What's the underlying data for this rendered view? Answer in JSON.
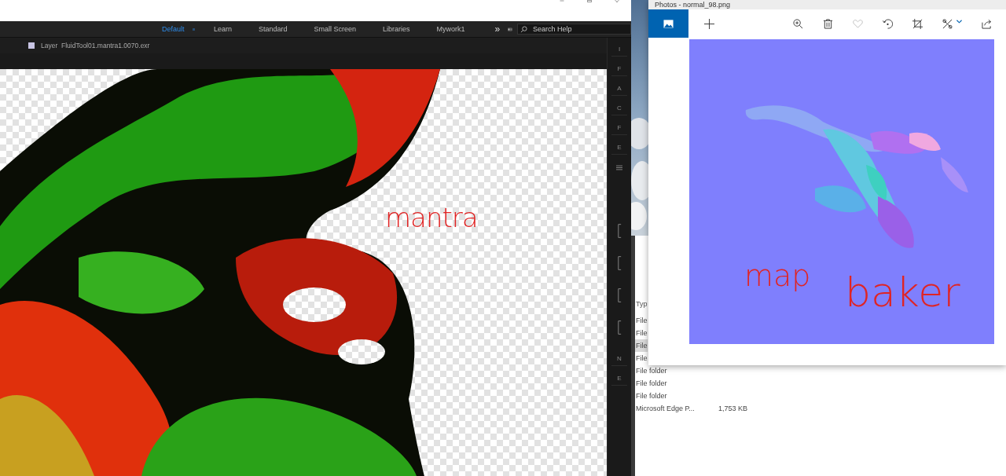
{
  "ae_window": {
    "workspaces": [
      {
        "label": "Default",
        "selected": true
      },
      {
        "label": "Learn",
        "selected": false
      },
      {
        "label": "Standard",
        "selected": false
      },
      {
        "label": "Small Screen",
        "selected": false
      },
      {
        "label": "Libraries",
        "selected": false
      },
      {
        "label": "Mywork1",
        "selected": false
      }
    ],
    "overflow": "»",
    "search": {
      "placeholder": "Search Help"
    },
    "panel": {
      "title": "Layer  FluidTool01.mantra1.0070.exr"
    },
    "viewer": {
      "kind": "picture",
      "annotation": "mantra"
    },
    "side_tabs_top": [
      "I",
      "F",
      "A",
      "C",
      "F",
      "E"
    ],
    "side_tabs_bottom": [
      "N",
      "E"
    ]
  },
  "explorer": {
    "column": "Typ",
    "rows": [
      {
        "type": "File",
        "selected": false
      },
      {
        "type": "File",
        "selected": false
      },
      {
        "type": "File",
        "selected": true
      },
      {
        "type": "File",
        "selected": false
      },
      {
        "type": "File folder",
        "selected": false
      },
      {
        "type": "File folder",
        "selected": false
      },
      {
        "type": "File folder",
        "selected": false
      },
      {
        "type": "Microsoft Edge P...",
        "size": "1,753 KB",
        "selected": false
      }
    ]
  },
  "photos": {
    "title": "Photos - normal_98.png",
    "favorite": false,
    "image": {
      "kind": "picture",
      "annotations": [
        "map",
        "baker"
      ]
    }
  }
}
